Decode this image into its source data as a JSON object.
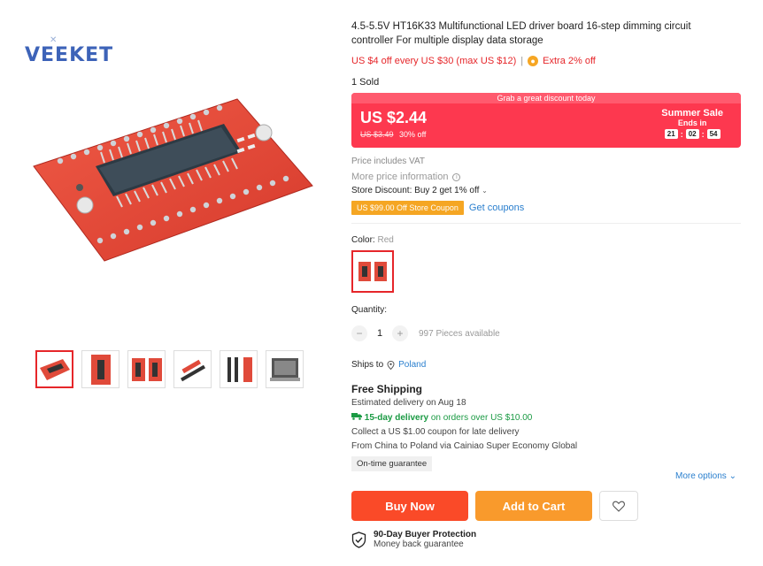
{
  "brand": {
    "name": "VEEKET",
    "prefix": "V",
    "rest": "EEKET"
  },
  "product": {
    "title": "4.5-5.5V HT16K33 Multifunctional LED driver board 16-step dimming circuit controller For multiple display data storage",
    "promo": "US $4 off every US $30 (max US $12)",
    "promo_sep": "|",
    "extra": "Extra 2% off",
    "sold": "1 Sold"
  },
  "deal": {
    "banner": "Grab a great discount today",
    "price": "US $2.44",
    "old_price": "US $3.49",
    "discount": "30% off",
    "sale_title": "Summer Sale",
    "ends_in": "Ends in",
    "timer": [
      "21",
      "02",
      "54"
    ],
    "colon": ":"
  },
  "pricing": {
    "vat": "Price includes VAT",
    "more_price": "More price information",
    "store_discount": "Store Discount: Buy 2 get 1% off",
    "coupon": "US $99.00 Off Store Coupon",
    "get_coupons": "Get coupons"
  },
  "color": {
    "label": "Color:",
    "value": "Red"
  },
  "quantity": {
    "label": "Quantity:",
    "minus": "−",
    "value": "1",
    "plus": "+",
    "available": "997 Pieces available"
  },
  "shipping": {
    "ships_to_label": "Ships to",
    "country": "Poland",
    "free": "Free Shipping",
    "estimated": "Estimated delivery on Aug 18",
    "fast": "15-day delivery",
    "fast_rest": "on orders over US $10.00",
    "coupon_late": "Collect a US $1.00 coupon for late delivery",
    "from": "From China to Poland via Cainiao Super Economy Global",
    "ontime": "On-time guarantee",
    "more_options": "More options"
  },
  "actions": {
    "buy_now": "Buy Now",
    "add_to_cart": "Add to Cart"
  },
  "protection": {
    "title": "90-Day Buyer Protection",
    "subtitle": "Money back guarantee"
  },
  "colors": {
    "accent": "#fd384f",
    "buy": "#fa4a28",
    "cart": "#f99a2c",
    "link": "#2a7fce",
    "board": "#e04a3a"
  },
  "icons": [
    "info-icon",
    "coin-icon",
    "location-pin-icon",
    "truck-icon",
    "heart-icon",
    "shield-check-icon",
    "chevron-down-icon"
  ]
}
